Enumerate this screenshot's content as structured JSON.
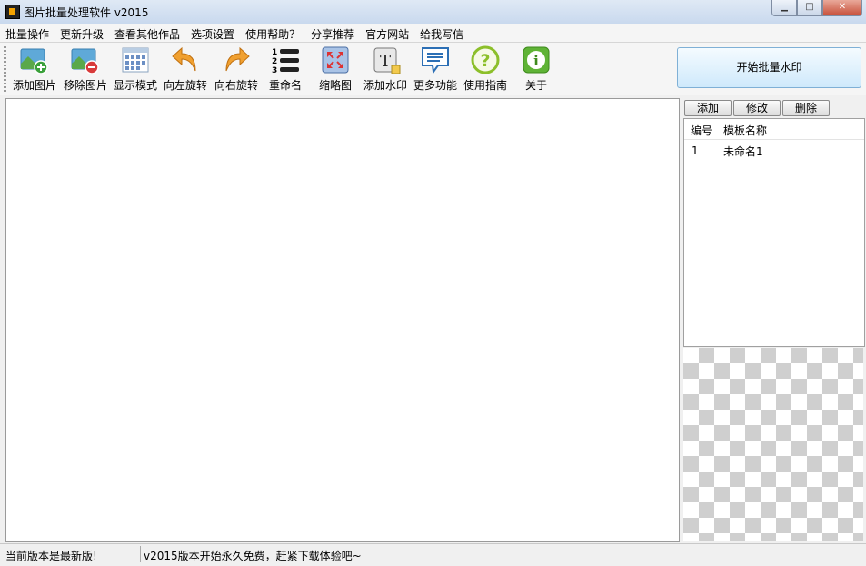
{
  "window": {
    "title": "图片批量处理软件 v2015",
    "minimize": "▁",
    "maximize": "□",
    "close": "✕"
  },
  "menu": [
    "批量操作",
    "更新升级",
    "查看其他作品",
    "选项设置",
    "使用帮助？",
    "分享推荐",
    "官方网站",
    "给我写信"
  ],
  "toolbar": {
    "add_image": "添加图片",
    "remove_image": "移除图片",
    "display_mode": "显示模式",
    "rotate_left": "向左旋转",
    "rotate_right": "向右旋转",
    "rename": "重命名",
    "thumbnail": "缩略图",
    "add_watermark": "添加水印",
    "more_features": "更多功能",
    "user_guide": "使用指南",
    "about": "关于"
  },
  "start_button": "开始批量水印",
  "template_panel": {
    "add": "添加",
    "modify": "修改",
    "delete": "删除",
    "col_id": "编号",
    "col_name": "模板名称",
    "rows": [
      {
        "id": "1",
        "name": "未命名1"
      }
    ]
  },
  "status": {
    "left": "当前版本是最新版!",
    "right": "v2015版本开始永久免费，赶紧下载体验吧~"
  },
  "icon_glyphs": {
    "rename_numbers": [
      "1",
      "2",
      "3"
    ],
    "watermark_letter": "T",
    "help_mark": "?",
    "info_mark": "i"
  }
}
